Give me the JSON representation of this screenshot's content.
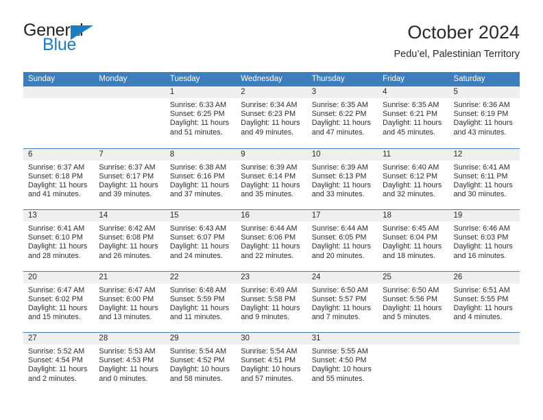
{
  "brand": {
    "name_dark": "General",
    "name_blue": "Blue",
    "accent_color": "#1a7dc4"
  },
  "header": {
    "title": "October 2024",
    "subtitle": "Pedu’el, Palestinian Territory",
    "header_bg": "#3d7ebb",
    "daynum_bg": "#efefef"
  },
  "weekdays": [
    "Sunday",
    "Monday",
    "Tuesday",
    "Wednesday",
    "Thursday",
    "Friday",
    "Saturday"
  ],
  "weeks": [
    [
      {
        "day": "",
        "sunrise": "",
        "sunset": "",
        "daylight1": "",
        "daylight2": ""
      },
      {
        "day": "",
        "sunrise": "",
        "sunset": "",
        "daylight1": "",
        "daylight2": ""
      },
      {
        "day": "1",
        "sunrise": "Sunrise: 6:33 AM",
        "sunset": "Sunset: 6:25 PM",
        "daylight1": "Daylight: 11 hours",
        "daylight2": "and 51 minutes."
      },
      {
        "day": "2",
        "sunrise": "Sunrise: 6:34 AM",
        "sunset": "Sunset: 6:23 PM",
        "daylight1": "Daylight: 11 hours",
        "daylight2": "and 49 minutes."
      },
      {
        "day": "3",
        "sunrise": "Sunrise: 6:35 AM",
        "sunset": "Sunset: 6:22 PM",
        "daylight1": "Daylight: 11 hours",
        "daylight2": "and 47 minutes."
      },
      {
        "day": "4",
        "sunrise": "Sunrise: 6:35 AM",
        "sunset": "Sunset: 6:21 PM",
        "daylight1": "Daylight: 11 hours",
        "daylight2": "and 45 minutes."
      },
      {
        "day": "5",
        "sunrise": "Sunrise: 6:36 AM",
        "sunset": "Sunset: 6:19 PM",
        "daylight1": "Daylight: 11 hours",
        "daylight2": "and 43 minutes."
      }
    ],
    [
      {
        "day": "6",
        "sunrise": "Sunrise: 6:37 AM",
        "sunset": "Sunset: 6:18 PM",
        "daylight1": "Daylight: 11 hours",
        "daylight2": "and 41 minutes."
      },
      {
        "day": "7",
        "sunrise": "Sunrise: 6:37 AM",
        "sunset": "Sunset: 6:17 PM",
        "daylight1": "Daylight: 11 hours",
        "daylight2": "and 39 minutes."
      },
      {
        "day": "8",
        "sunrise": "Sunrise: 6:38 AM",
        "sunset": "Sunset: 6:16 PM",
        "daylight1": "Daylight: 11 hours",
        "daylight2": "and 37 minutes."
      },
      {
        "day": "9",
        "sunrise": "Sunrise: 6:39 AM",
        "sunset": "Sunset: 6:14 PM",
        "daylight1": "Daylight: 11 hours",
        "daylight2": "and 35 minutes."
      },
      {
        "day": "10",
        "sunrise": "Sunrise: 6:39 AM",
        "sunset": "Sunset: 6:13 PM",
        "daylight1": "Daylight: 11 hours",
        "daylight2": "and 33 minutes."
      },
      {
        "day": "11",
        "sunrise": "Sunrise: 6:40 AM",
        "sunset": "Sunset: 6:12 PM",
        "daylight1": "Daylight: 11 hours",
        "daylight2": "and 32 minutes."
      },
      {
        "day": "12",
        "sunrise": "Sunrise: 6:41 AM",
        "sunset": "Sunset: 6:11 PM",
        "daylight1": "Daylight: 11 hours",
        "daylight2": "and 30 minutes."
      }
    ],
    [
      {
        "day": "13",
        "sunrise": "Sunrise: 6:41 AM",
        "sunset": "Sunset: 6:10 PM",
        "daylight1": "Daylight: 11 hours",
        "daylight2": "and 28 minutes."
      },
      {
        "day": "14",
        "sunrise": "Sunrise: 6:42 AM",
        "sunset": "Sunset: 6:08 PM",
        "daylight1": "Daylight: 11 hours",
        "daylight2": "and 26 minutes."
      },
      {
        "day": "15",
        "sunrise": "Sunrise: 6:43 AM",
        "sunset": "Sunset: 6:07 PM",
        "daylight1": "Daylight: 11 hours",
        "daylight2": "and 24 minutes."
      },
      {
        "day": "16",
        "sunrise": "Sunrise: 6:44 AM",
        "sunset": "Sunset: 6:06 PM",
        "daylight1": "Daylight: 11 hours",
        "daylight2": "and 22 minutes."
      },
      {
        "day": "17",
        "sunrise": "Sunrise: 6:44 AM",
        "sunset": "Sunset: 6:05 PM",
        "daylight1": "Daylight: 11 hours",
        "daylight2": "and 20 minutes."
      },
      {
        "day": "18",
        "sunrise": "Sunrise: 6:45 AM",
        "sunset": "Sunset: 6:04 PM",
        "daylight1": "Daylight: 11 hours",
        "daylight2": "and 18 minutes."
      },
      {
        "day": "19",
        "sunrise": "Sunrise: 6:46 AM",
        "sunset": "Sunset: 6:03 PM",
        "daylight1": "Daylight: 11 hours",
        "daylight2": "and 16 minutes."
      }
    ],
    [
      {
        "day": "20",
        "sunrise": "Sunrise: 6:47 AM",
        "sunset": "Sunset: 6:02 PM",
        "daylight1": "Daylight: 11 hours",
        "daylight2": "and 15 minutes."
      },
      {
        "day": "21",
        "sunrise": "Sunrise: 6:47 AM",
        "sunset": "Sunset: 6:00 PM",
        "daylight1": "Daylight: 11 hours",
        "daylight2": "and 13 minutes."
      },
      {
        "day": "22",
        "sunrise": "Sunrise: 6:48 AM",
        "sunset": "Sunset: 5:59 PM",
        "daylight1": "Daylight: 11 hours",
        "daylight2": "and 11 minutes."
      },
      {
        "day": "23",
        "sunrise": "Sunrise: 6:49 AM",
        "sunset": "Sunset: 5:58 PM",
        "daylight1": "Daylight: 11 hours",
        "daylight2": "and 9 minutes."
      },
      {
        "day": "24",
        "sunrise": "Sunrise: 6:50 AM",
        "sunset": "Sunset: 5:57 PM",
        "daylight1": "Daylight: 11 hours",
        "daylight2": "and 7 minutes."
      },
      {
        "day": "25",
        "sunrise": "Sunrise: 6:50 AM",
        "sunset": "Sunset: 5:56 PM",
        "daylight1": "Daylight: 11 hours",
        "daylight2": "and 5 minutes."
      },
      {
        "day": "26",
        "sunrise": "Sunrise: 6:51 AM",
        "sunset": "Sunset: 5:55 PM",
        "daylight1": "Daylight: 11 hours",
        "daylight2": "and 4 minutes."
      }
    ],
    [
      {
        "day": "27",
        "sunrise": "Sunrise: 5:52 AM",
        "sunset": "Sunset: 4:54 PM",
        "daylight1": "Daylight: 11 hours",
        "daylight2": "and 2 minutes."
      },
      {
        "day": "28",
        "sunrise": "Sunrise: 5:53 AM",
        "sunset": "Sunset: 4:53 PM",
        "daylight1": "Daylight: 11 hours",
        "daylight2": "and 0 minutes."
      },
      {
        "day": "29",
        "sunrise": "Sunrise: 5:54 AM",
        "sunset": "Sunset: 4:52 PM",
        "daylight1": "Daylight: 10 hours",
        "daylight2": "and 58 minutes."
      },
      {
        "day": "30",
        "sunrise": "Sunrise: 5:54 AM",
        "sunset": "Sunset: 4:51 PM",
        "daylight1": "Daylight: 10 hours",
        "daylight2": "and 57 minutes."
      },
      {
        "day": "31",
        "sunrise": "Sunrise: 5:55 AM",
        "sunset": "Sunset: 4:50 PM",
        "daylight1": "Daylight: 10 hours",
        "daylight2": "and 55 minutes."
      },
      {
        "day": "",
        "sunrise": "",
        "sunset": "",
        "daylight1": "",
        "daylight2": ""
      },
      {
        "day": "",
        "sunrise": "",
        "sunset": "",
        "daylight1": "",
        "daylight2": ""
      }
    ]
  ]
}
